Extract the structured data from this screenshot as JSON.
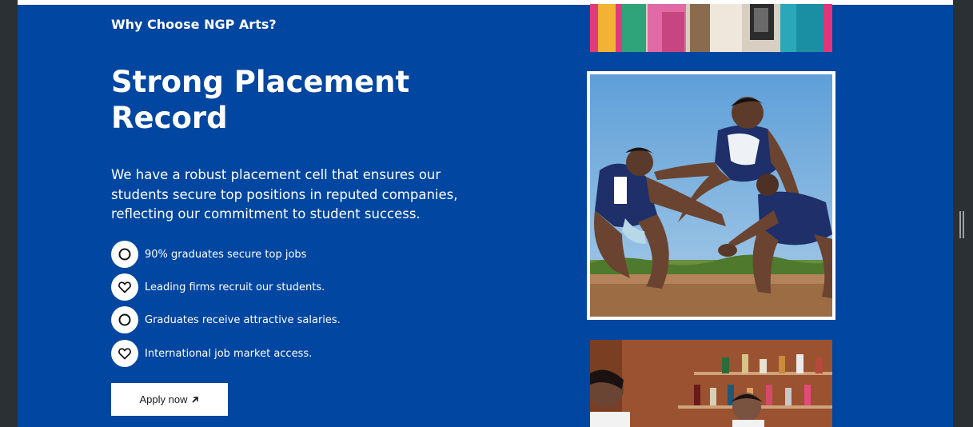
{
  "section": {
    "eyebrow": "Why Choose NGP Arts?",
    "headline": "Strong Placement Record",
    "description": "We have a robust placement cell that ensures our students secure top positions in reputed companies, reflecting our commitment to student success."
  },
  "features": [
    {
      "label": "90% graduates secure top jobs",
      "icon": "circle-icon"
    },
    {
      "label": "Leading firms recruit our students.",
      "icon": "heart-icon"
    },
    {
      "label": "Graduates receive attractive salaries.",
      "icon": "circle-icon"
    },
    {
      "label": "International job market access.",
      "icon": "heart-icon"
    }
  ],
  "cta": {
    "label": "Apply now",
    "icon": "arrow-up-right-icon"
  },
  "images": {
    "top": "students-in-colorful-attire-photo",
    "main": "kabaddi-players-photo",
    "bottom": "hospitality-students-bar-photo"
  },
  "colors": {
    "panel_bg": "#0146a0",
    "text": "#ffffff",
    "button_bg": "#ffffff",
    "button_text": "#1a1a1a",
    "frame": "#2b3035"
  }
}
